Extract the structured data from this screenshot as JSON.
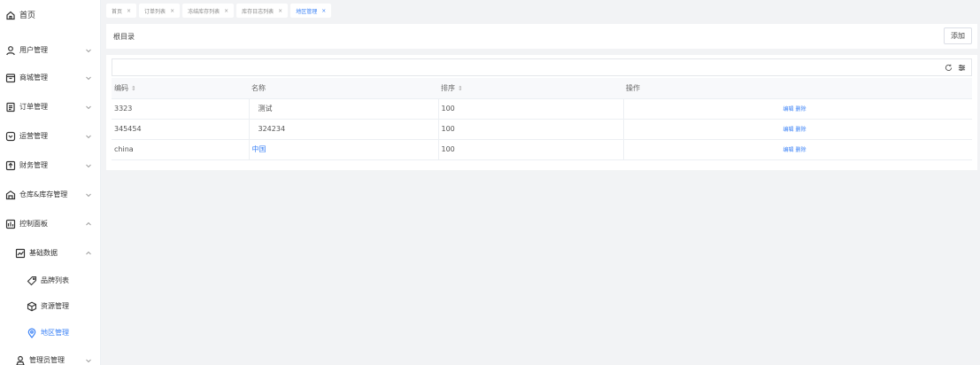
{
  "sidebar": {
    "items": [
      {
        "label": "首页",
        "icon": "home-icon"
      },
      {
        "label": "用户管理",
        "icon": "user-icon"
      },
      {
        "label": "商城管理",
        "icon": "shop-icon"
      },
      {
        "label": "订单管理",
        "icon": "order-icon"
      },
      {
        "label": "运营管理",
        "icon": "operation-icon"
      },
      {
        "label": "财务管理",
        "icon": "finance-icon"
      },
      {
        "label": "仓库&库存管理",
        "icon": "warehouse-icon"
      },
      {
        "label": "控制面板",
        "icon": "dashboard-icon"
      },
      {
        "label": "基础数据",
        "icon": "chart-icon"
      },
      {
        "label": "品牌列表",
        "icon": "tag-icon"
      },
      {
        "label": "资源管理",
        "icon": "cube-icon"
      },
      {
        "label": "地区管理",
        "icon": "location-icon"
      },
      {
        "label": "管理员管理",
        "icon": "admin-icon"
      }
    ]
  },
  "tabs": [
    {
      "label": "首页",
      "active": false
    },
    {
      "label": "订单列表",
      "active": false
    },
    {
      "label": "冻结库存列表",
      "active": false
    },
    {
      "label": "库存日志列表",
      "active": false
    },
    {
      "label": "地区管理",
      "active": true
    }
  ],
  "tab_close": "×",
  "root": {
    "title": "根目录",
    "add_label": "添加"
  },
  "table": {
    "headers": [
      "编码",
      "名称",
      "排序",
      "操作"
    ],
    "sort_glyph": "⇕",
    "rows": [
      {
        "code": "3323",
        "name": "测试",
        "sort": "100",
        "edit": "编辑",
        "delete": "删除"
      },
      {
        "code": "345454",
        "name": "324234",
        "sort": "100",
        "edit": "编辑",
        "delete": "删除"
      },
      {
        "code": "china",
        "name": "中国",
        "sort": "100",
        "edit": "编辑",
        "delete": "删除"
      }
    ]
  },
  "colors": {
    "accent": "#3b82f6",
    "background": "#f2f3f5"
  }
}
